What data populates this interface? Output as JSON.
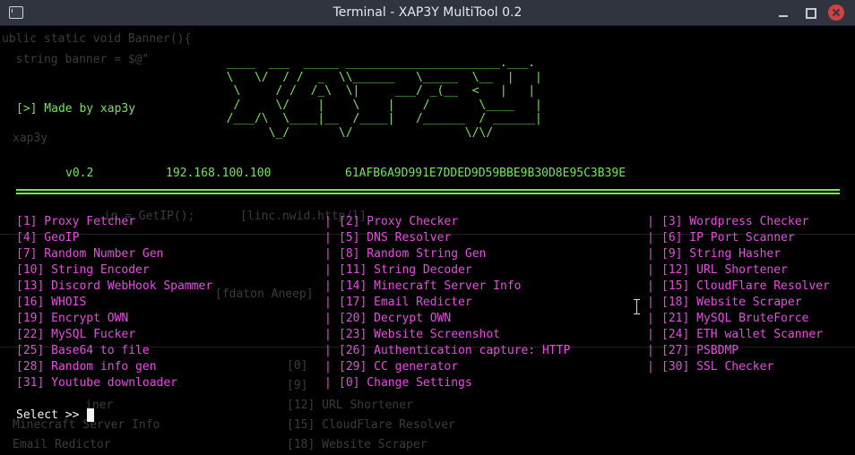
{
  "window": {
    "title": "Terminal - XAP3Y MultiTool 0.2"
  },
  "background_text": [
    "ublic static void Banner(){",
    "  string banner = $@\"",
    "xap3y",
    "  ip = GetIP();",
    "[linc.nwid.http/l]",
    "[fdaton Aneep]",
    "[0]",
    "[9]",
    "[12] URL Shortener",
    "[15] CloudFlare Resolver",
    "[18] Website Scraper",
    "iner",
    "Minecraft Server Info",
    "Email Redictor"
  ],
  "banner": {
    "made_by": "[>] Made by xap3y",
    "ascii_art": "  ____  ___  _____ ______________________.___.\n  \\   \\/  / /  _  \\\\______   \\_____  \\__  |   |\n   \\     / /  /_\\  \\|     ___/ _(__  <   |   |\n   /     \\/    |    \\    |    /       \\____   |\n  /___/\\  \\____|__  /____|   /______  / ______|\n        \\_/       \\/                \\/\\/",
    "version": "v0.2",
    "ip": "192.168.100.100",
    "hwid": "61AFB6A9D991E7DDED9D59BBE9B30D8E95C3B39E"
  },
  "menu": {
    "col1": [
      "[1] Proxy Fetcher",
      "[4] GeoIP",
      "[7] Random Number Gen",
      "[10] String Encoder",
      "[13] Discord WebHook Spammer",
      "[16] WHOIS",
      "[19] Encrypt OWN",
      "[22] MySQL Fucker",
      "[25] Base64 to file",
      "[28] Random info gen",
      "[31] Youtube downloader"
    ],
    "col2": [
      "[2] Proxy Checker",
      "[5] DNS Resolver",
      "[8] Random String Gen",
      "[11] String Decoder",
      "[14] Minecraft Server Info",
      "[17] Email Redicter",
      "[20] Decrypt OWN",
      "[23] Website Screenshot",
      "[26] Authentication capture: HTTP",
      "[29] CC generator",
      "[0] Change Settings"
    ],
    "col3": [
      "[3] Wordpress Checker",
      "[6] IP Port Scanner",
      "[9] String Hasher",
      "[12] URL Shortener",
      "[15] CloudFlare Resolver",
      "[18] Website Scraper",
      "[21] MySQL BruteForce",
      "[24] ETH wallet Scanner",
      "[27] PSBDMP",
      "[30] SSL Checker"
    ],
    "separator": "|"
  },
  "prompt": {
    "label": "Select >> "
  },
  "colors": {
    "accent_green": "#76e25c",
    "menu_magenta": "#e84be0",
    "titlebar": "#2f343f",
    "background": "#000000"
  }
}
